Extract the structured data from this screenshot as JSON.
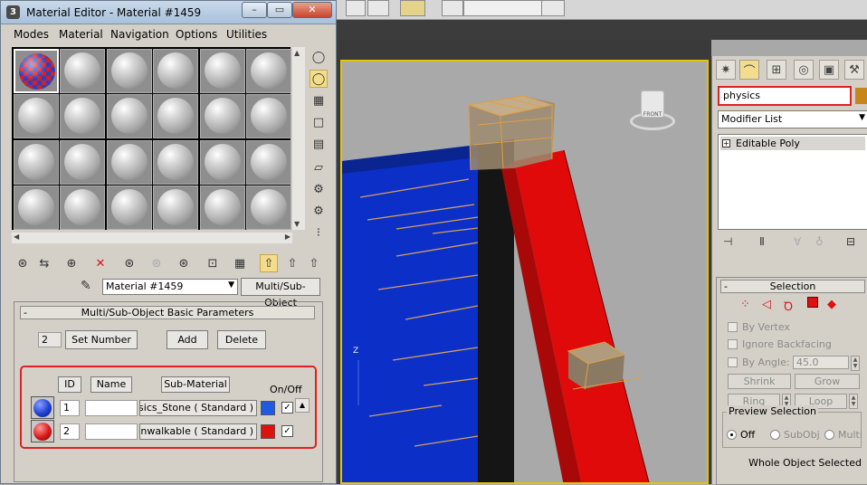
{
  "material_editor": {
    "title": "Material Editor - Material #1459",
    "window_buttons": {
      "minimize": "–",
      "maximize": "▭",
      "close": "✕"
    },
    "menus": [
      "Modes",
      "Material",
      "Navigation",
      "Options",
      "Utilities"
    ],
    "material_name": "Material #1459",
    "material_type_button": "Multi/Sub-Object",
    "params": {
      "title": "Multi/Sub-Object Basic Parameters",
      "collapse_glyph": "-",
      "sub_count": "2",
      "set_number_label": "Set Number",
      "add_label": "Add",
      "delete_label": "Delete",
      "headers": {
        "id": "ID",
        "name": "Name",
        "sub_material": "Sub-Material",
        "on_off": "On/Off"
      },
      "rows": [
        {
          "id": "1",
          "name": "",
          "sub_material": "Physics_Stone  ( Standard )",
          "color": "#1e5ae6",
          "sphere_color": "#2040d0",
          "enabled": "✓"
        },
        {
          "id": "2",
          "name": "",
          "sub_material": "Physics_Unwalkable  ( Standard )",
          "color": "#e01010",
          "sphere_color": "#d81818",
          "enabled": "✓"
        }
      ]
    }
  },
  "command_panel": {
    "object_name": "physics",
    "modifier_list": "Modifier List",
    "stack_items": [
      "Editable Poly"
    ],
    "selection": {
      "title": "Selection",
      "by_vertex": "By Vertex",
      "ignore_backfacing": "Ignore Backfacing",
      "by_angle": "By Angle:",
      "angle_value": "45.0",
      "shrink": "Shrink",
      "grow": "Grow",
      "ring": "Ring",
      "loop": "Loop",
      "preview_selection": "Preview Selection",
      "preview_options": [
        "Off",
        "SubObj",
        "Multi"
      ],
      "status": "Whole Object Selected"
    }
  },
  "viewport": {
    "viewcube_label": "FRONT",
    "axis_label": "Z"
  },
  "colors": {
    "selection_highlight": "#e02020",
    "viewport_border": "#e8c400",
    "floor_blue": "#0c2fc8",
    "beam_red": "#e00a0a"
  }
}
